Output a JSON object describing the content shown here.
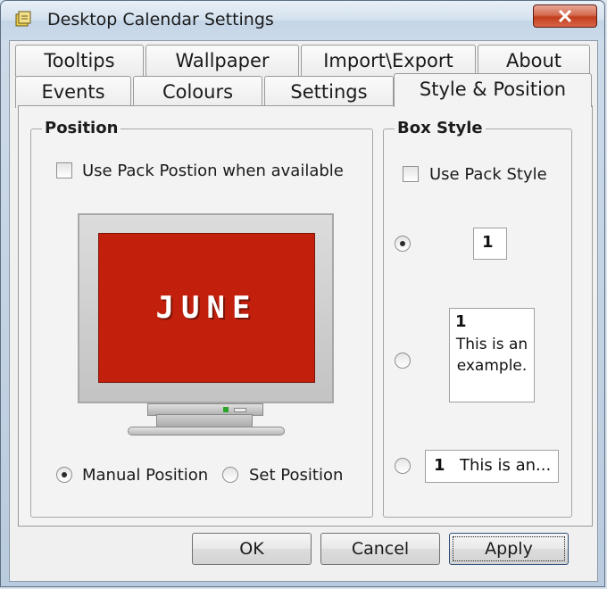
{
  "window": {
    "title": "Desktop Calendar Settings"
  },
  "tabs_row_back": [
    {
      "label": "Tooltips"
    },
    {
      "label": "Wallpaper"
    },
    {
      "label": "Import\\Export"
    },
    {
      "label": "About"
    }
  ],
  "tabs_row_front": [
    {
      "label": "Events"
    },
    {
      "label": "Colours"
    },
    {
      "label": "Settings"
    },
    {
      "label": "Style & Position",
      "active": true
    }
  ],
  "position_group": {
    "label": "Position",
    "use_pack_position": {
      "label": "Use Pack Postion when available",
      "checked": false
    },
    "monitor_preview_text": "JUNE",
    "monitor_screen_color": "#c21f0c",
    "manual_position": {
      "label": "Manual Position",
      "checked": true
    },
    "set_position": {
      "label": "Set Position",
      "checked": false
    }
  },
  "box_style_group": {
    "label": "Box Style",
    "use_pack_style": {
      "label": "Use Pack Style",
      "checked": false
    },
    "option1": {
      "checked": true,
      "preview_number": "1"
    },
    "option2": {
      "checked": false,
      "preview_number": "1",
      "preview_line1": "This is an",
      "preview_line2": "example."
    },
    "option3": {
      "checked": false,
      "preview_number": "1",
      "preview_text": "This is an..."
    }
  },
  "buttons": {
    "ok": "OK",
    "cancel": "Cancel",
    "apply": "Apply"
  }
}
